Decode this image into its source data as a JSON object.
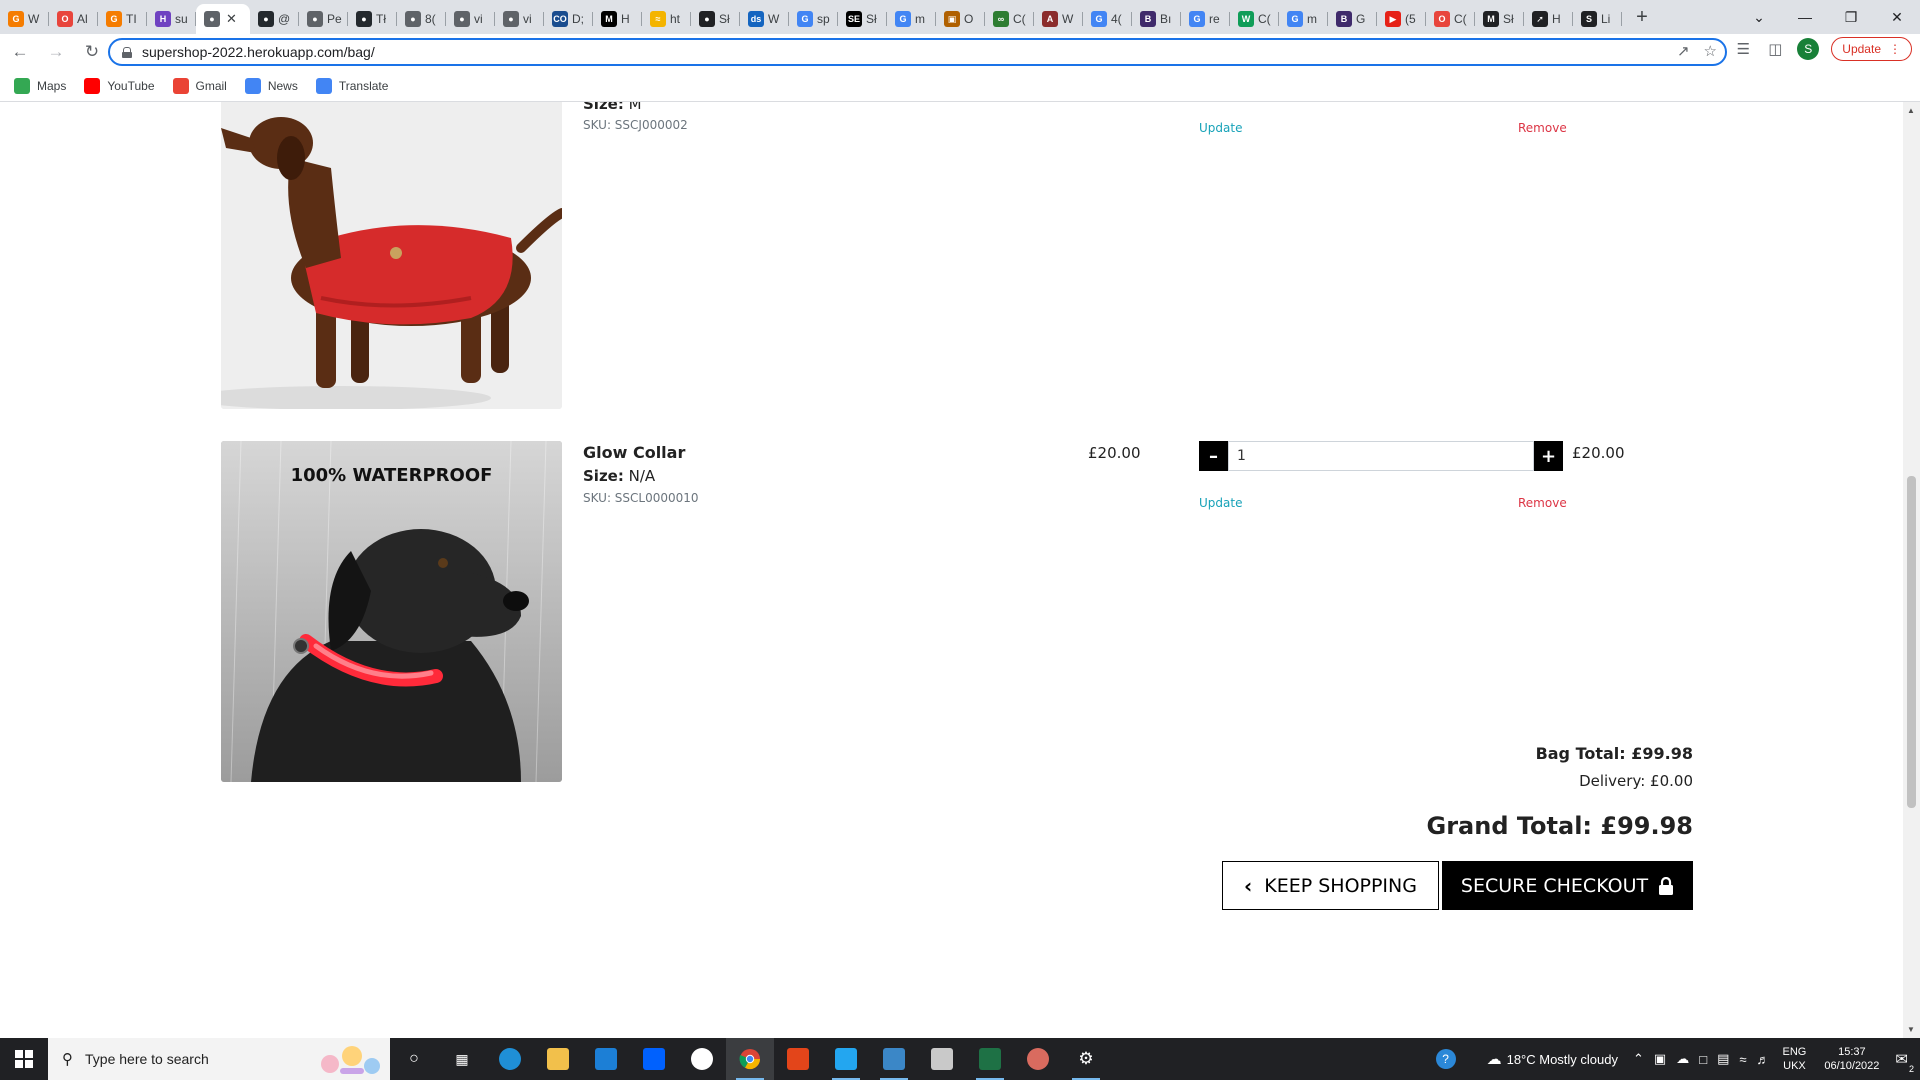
{
  "browser": {
    "tabs": [
      {
        "label": "W",
        "favicon_color": "#f57c00",
        "favicon": "G"
      },
      {
        "label": "Al",
        "favicon_color": "#e8453c",
        "favicon": "O"
      },
      {
        "label": "TI",
        "favicon_color": "#f57c00",
        "favicon": "G"
      },
      {
        "label": "su",
        "favicon_color": "#6f42c1",
        "favicon": "H"
      },
      {
        "label": "",
        "favicon_color": "#5f6368",
        "favicon": "●",
        "active": true
      },
      {
        "label": "@",
        "favicon_color": "#24292e",
        "favicon": "●"
      },
      {
        "label": "Pe",
        "favicon_color": "#5f6368",
        "favicon": "●"
      },
      {
        "label": "Tł",
        "favicon_color": "#24292e",
        "favicon": "●"
      },
      {
        "label": "8(",
        "favicon_color": "#5f6368",
        "favicon": "●"
      },
      {
        "label": "vi",
        "favicon_color": "#5f6368",
        "favicon": "●"
      },
      {
        "label": "vi",
        "favicon_color": "#5f6368",
        "favicon": "●"
      },
      {
        "label": "D;",
        "favicon_color": "#1a4d8f",
        "favicon": "CO"
      },
      {
        "label": "H",
        "favicon_color": "#000000",
        "favicon": "M"
      },
      {
        "label": "ht",
        "favicon_color": "#f4b400",
        "favicon": "≈"
      },
      {
        "label": "Sł",
        "favicon_color": "#202124",
        "favicon": "●"
      },
      {
        "label": "W",
        "favicon_color": "#1565c0",
        "favicon": "ds"
      },
      {
        "label": "sp",
        "favicon_color": "#4285f4",
        "favicon": "G"
      },
      {
        "label": "Sł",
        "favicon_color": "#000000",
        "favicon": "SE"
      },
      {
        "label": "m",
        "favicon_color": "#4285f4",
        "favicon": "G"
      },
      {
        "label": "O",
        "favicon_color": "#b06000",
        "favicon": "▣"
      },
      {
        "label": "C(",
        "favicon_color": "#2e7d32",
        "favicon": "∞"
      },
      {
        "label": "W",
        "favicon_color": "#8b2c2c",
        "favicon": "A"
      },
      {
        "label": "4(",
        "favicon_color": "#4285f4",
        "favicon": "G"
      },
      {
        "label": "Bı",
        "favicon_color": "#3f2a6b",
        "favicon": "B"
      },
      {
        "label": "re",
        "favicon_color": "#4285f4",
        "favicon": "G"
      },
      {
        "label": "C(",
        "favicon_color": "#0f9d58",
        "favicon": "W"
      },
      {
        "label": "m",
        "favicon_color": "#4285f4",
        "favicon": "G"
      },
      {
        "label": "G",
        "favicon_color": "#3f2a6b",
        "favicon": "B"
      },
      {
        "label": "(5",
        "favicon_color": "#e62117",
        "favicon": "▶"
      },
      {
        "label": "C(",
        "favicon_color": "#e8453c",
        "favicon": "O"
      },
      {
        "label": "Sł",
        "favicon_color": "#202124",
        "favicon": "M"
      },
      {
        "label": "H",
        "favicon_color": "#202124",
        "favicon": "➚"
      },
      {
        "label": "Li",
        "favicon_color": "#202124",
        "favicon": "S"
      }
    ],
    "new_tab_label": "+",
    "url": "supershop-2022.herokuapp.com/bag/",
    "update_label": "Update",
    "avatar_initial": "S",
    "bookmarks": [
      {
        "label": "Maps",
        "color": "#34a853"
      },
      {
        "label": "YouTube",
        "color": "#ff0000"
      },
      {
        "label": "Gmail",
        "color": "#ea4335"
      },
      {
        "label": "News",
        "color": "#4285f4"
      },
      {
        "label": "Translate",
        "color": "#4285f4"
      }
    ]
  },
  "bag": {
    "items": [
      {
        "name": "",
        "size_label": "Size:",
        "size_value": "M",
        "sku": "SKU: SSCJ000002",
        "price": "",
        "quantity": "",
        "subtotal": "",
        "update_label": "Update",
        "remove_label": "Remove",
        "image": "red-dog-jacket"
      },
      {
        "name": "Glow Collar",
        "size_label": "Size:",
        "size_value": "N/A",
        "sku": "SKU: SSCL0000010",
        "price": "£20.00",
        "quantity": "1",
        "subtotal": "£20.00",
        "update_label": "Update",
        "remove_label": "Remove",
        "image": "glow-collar",
        "image_caption": "100% WATERPROOF"
      }
    ],
    "bag_total": "Bag Total: £99.98",
    "delivery": "Delivery: £0.00",
    "grand_total": "Grand Total: £99.98",
    "keep_shopping_label": "KEEP SHOPPING",
    "secure_checkout_label": "SECURE CHECKOUT"
  },
  "taskbar": {
    "search_placeholder": "Type here to search",
    "weather": "18°C  Mostly cloudy",
    "lang_line1": "ENG",
    "lang_line2": "UKX",
    "time": "15:37",
    "date": "06/10/2022",
    "notifications": "2"
  }
}
